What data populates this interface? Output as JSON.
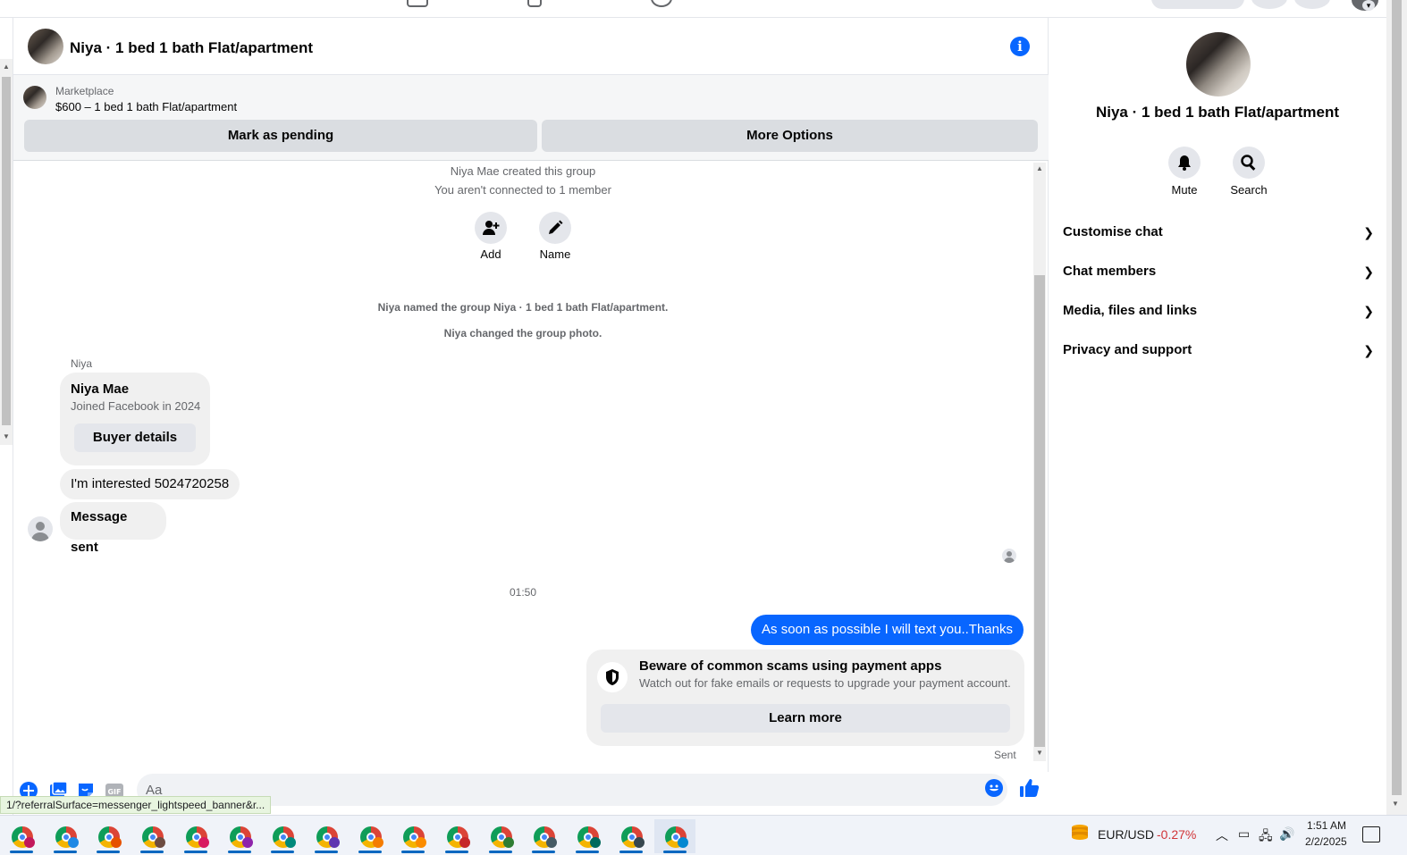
{
  "chat": {
    "title": "Niya · 1 bed 1 bath Flat/apartment",
    "marketplace_label": "Marketplace",
    "listing_price_title": "$600 – 1 bed 1 bath Flat/apartment",
    "mark_pending_label": "Mark as pending",
    "more_options_label": "More Options"
  },
  "messages": {
    "created_group": "Niya Mae created this group",
    "not_connected": "You aren't connected to 1 member",
    "add_label": "Add",
    "name_label": "Name",
    "named_group": "Niya named the group Niya · 1 bed 1 bath Flat/apartment.",
    "changed_photo": "Niya changed the group photo.",
    "sender_name": "Niya",
    "card_name": "Niya Mae",
    "card_joined": "Joined Facebook in 2024",
    "buyer_details_label": "Buyer details",
    "interested_text": "I'm interested 5024720258",
    "message_sent_text": "Message sent",
    "timestamp": "01:50",
    "my_message": "As soon as possible I will text you..Thanks",
    "scam_title": "Beware of common scams using payment apps",
    "scam_body": "Watch out for fake emails or requests to upgrade your payment account.",
    "learn_more_label": "Learn more",
    "sent_status": "Sent"
  },
  "composer": {
    "placeholder": "Aa",
    "icons": [
      "plus-circle-icon",
      "photo-icon",
      "sticker-icon",
      "gif-icon",
      "emoji-icon",
      "like-icon"
    ]
  },
  "status_url": "1/?referralSurface=messenger_lightspeed_banner&r...",
  "right_panel": {
    "title": "Niya · 1 bed 1 bath Flat/apartment",
    "mute_label": "Mute",
    "search_label": "Search",
    "sections": [
      "Customise chat",
      "Chat members",
      "Media, files and links",
      "Privacy and support"
    ]
  },
  "taskbar": {
    "ticker_name": "EUR/USD",
    "ticker_change": "-0.27%",
    "time": "1:51 AM",
    "date": "2/2/2025",
    "app_count": 16,
    "active_app_index": 15
  },
  "colors": {
    "accent": "#0866ff",
    "bubble_gray": "#f0f0f0",
    "negative": "#d13438"
  }
}
